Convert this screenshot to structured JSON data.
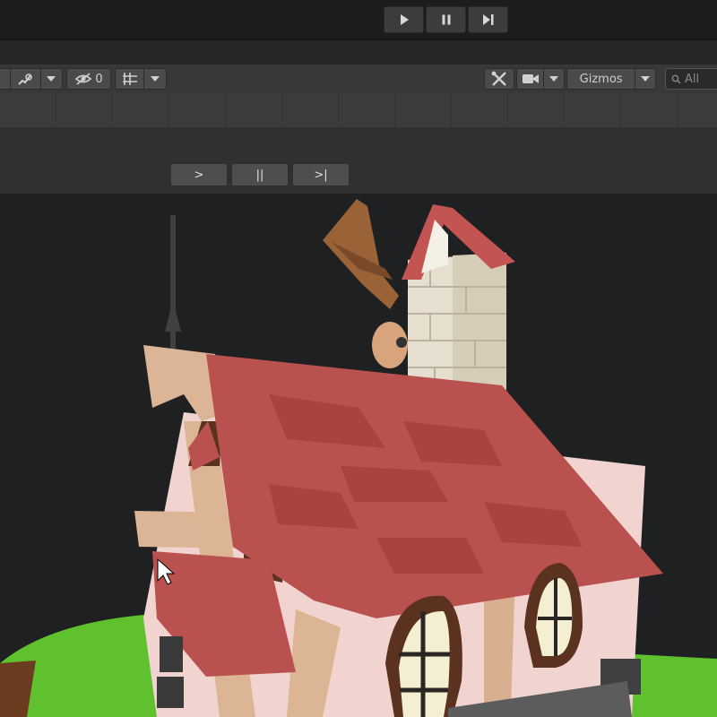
{
  "playbar": {
    "buttons": [
      {
        "name": "play-button",
        "icon": "play-icon"
      },
      {
        "name": "pause-button",
        "icon": "pause-icon"
      },
      {
        "name": "step-button",
        "icon": "step-forward-icon"
      }
    ]
  },
  "scene_toolbar": {
    "hidden_count": "0",
    "gizmos_label": "Gizmos",
    "search_placeholder": "All"
  },
  "timeline": {
    "play_label": ">",
    "pause_label": "||",
    "step_label": ">|"
  },
  "colors": {
    "roof": "#b4524f",
    "wall": "#f2d6d3",
    "beam": "#d9b291",
    "grass": "#62c42f",
    "tower": "#e6dfcf"
  }
}
